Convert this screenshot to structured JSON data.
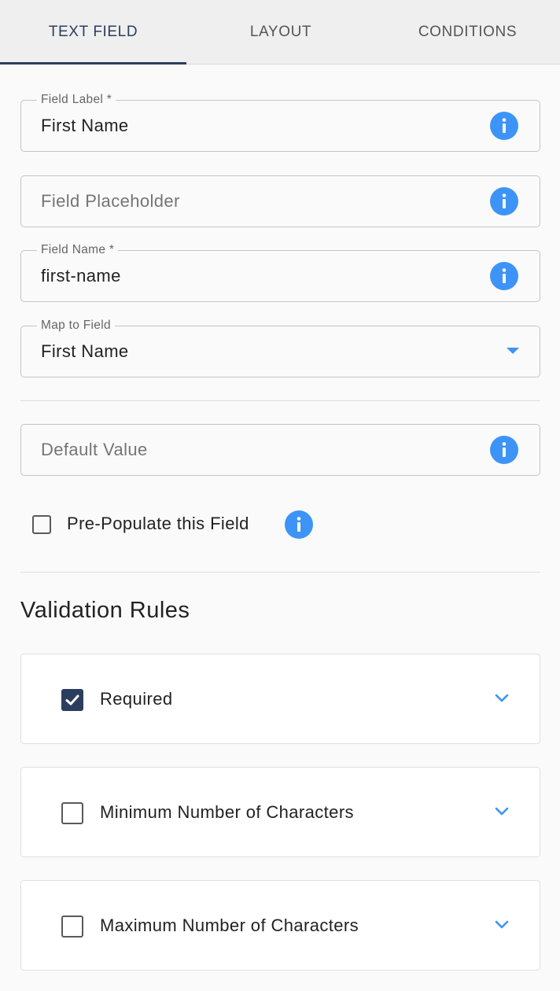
{
  "tabs": [
    {
      "label": "TEXT FIELD",
      "active": true
    },
    {
      "label": "LAYOUT",
      "active": false
    },
    {
      "label": "CONDITIONS",
      "active": false
    }
  ],
  "fields": {
    "field_label": {
      "label": "Field Label *",
      "value": "First Name",
      "icon": "info-icon"
    },
    "field_placeholder": {
      "placeholder": "Field Placeholder",
      "value": "",
      "icon": "info-icon"
    },
    "field_name": {
      "label": "Field Name *",
      "value": "first-name",
      "icon": "info-icon"
    },
    "map_to_field": {
      "label": "Map to Field",
      "value": "First Name",
      "icon": "dropdown-arrow-icon"
    },
    "default_value": {
      "placeholder": "Default Value",
      "value": "",
      "icon": "info-icon"
    }
  },
  "prepopulate": {
    "label": "Pre-Populate this Field",
    "checked": false
  },
  "validation": {
    "title": "Validation Rules",
    "rules": [
      {
        "label": "Required",
        "checked": true
      },
      {
        "label": "Minimum Number of Characters",
        "checked": false
      },
      {
        "label": "Maximum Number of Characters",
        "checked": false
      }
    ]
  },
  "colors": {
    "accent": "#3d94f6",
    "primary": "#2c3e5e",
    "background": "#fafafa"
  }
}
